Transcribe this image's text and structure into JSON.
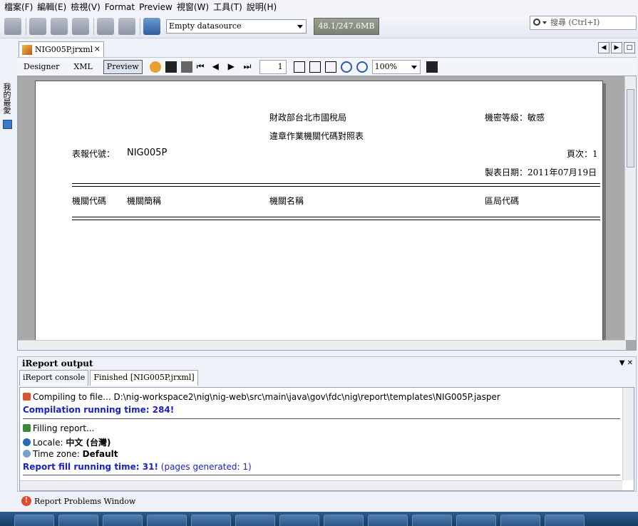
{
  "menu": [
    "檔案(F)",
    "編輯(E)",
    "檢視(V)",
    "Format",
    "Preview",
    "視窗(W)",
    "工具(T)",
    "說明(H)"
  ],
  "toolbar": {
    "datasource": "Empty datasource",
    "memory": "48.1/247.6MB",
    "search_placeholder": "搜尋 (Ctrl+I)"
  },
  "side_panel": {
    "label": "我的最愛"
  },
  "editor": {
    "tab_title": "NIG005P.jrxml",
    "tab_close": "×",
    "views": [
      "Designer",
      "XML",
      "Preview"
    ],
    "page_number": "1",
    "zoom": "100%"
  },
  "report": {
    "agency": "財政部台北市國稅局",
    "title": "違章作業機關代碼對照表",
    "security": "機密等級：敏感",
    "report_code_label": "表報代號：",
    "report_code": "NIG005P",
    "page_label": "頁次：1",
    "date_label": "製表日期：2011年07月19日",
    "columns": [
      "機關代碼",
      "機關簡稱",
      "機關名稱",
      "區局代碼"
    ]
  },
  "output": {
    "title": "iReport output",
    "tabs": [
      "iReport console",
      "Finished [NIG005P.jrxml]"
    ],
    "compile_line": "Compiling to file... D:\\nig-workspace2\\nig\\nig-web\\src\\main\\java\\gov\\fdc\\nig\\report\\templates\\NIG005P.jasper",
    "compile_time": "Compilation running time: 284!",
    "filling": "Filling report...",
    "locale_label": "Locale: ",
    "locale_value": "中文 (台灣)",
    "timezone_label": "Time zone: ",
    "timezone_value": "Default",
    "fill_time": "Report fill running time: 31!",
    "pages_generated": " (pages generated: 1)"
  },
  "problems": {
    "label": "Report Problems Window"
  },
  "colors": {
    "accent": "#1a22c7",
    "toolbar_bg": "#e4e8f0",
    "taskbar": "#173d66"
  }
}
